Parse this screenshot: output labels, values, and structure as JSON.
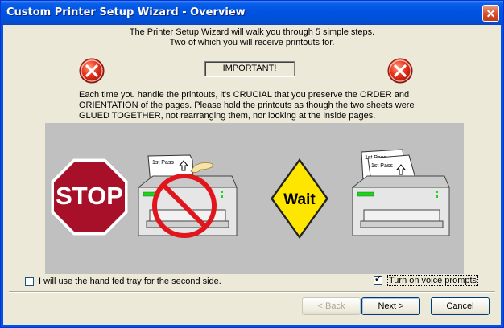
{
  "window": {
    "title": "Custom Printer Setup Wizard - Overview",
    "close_label": "✕"
  },
  "intro": {
    "line1": "The Printer Setup Wizard will walk you through 5 simple steps.",
    "line2": "Two of which you will receive printouts for."
  },
  "important_label": "IMPORTANT!",
  "instructions": "Each time you handle the printouts, it's CRUCIAL that you preserve the ORDER and ORIENTATION of the pages.  Please hold the printouts as though the two sheets were GLUED TOGETHER, not rearranging them, nor looking at the inside pages.",
  "illustration": {
    "stop_text": "STOP",
    "wait_text": "Wait",
    "page_label_1": "1st Pass",
    "page_label_2": "1st Pass",
    "page_label_3": "1st Pass",
    "colors": {
      "stop_red": "#a8102a",
      "wait_yellow": "#ffe600",
      "no_red": "#e0161c",
      "led_green": "#23d21f"
    }
  },
  "options": {
    "hand_fed": {
      "label": "I will use the hand fed tray for the second side.",
      "checked": false
    },
    "voice": {
      "label": "Turn on voice prompts",
      "checked": true
    }
  },
  "buttons": {
    "back": "< Back",
    "next": "Next >",
    "cancel": "Cancel"
  }
}
